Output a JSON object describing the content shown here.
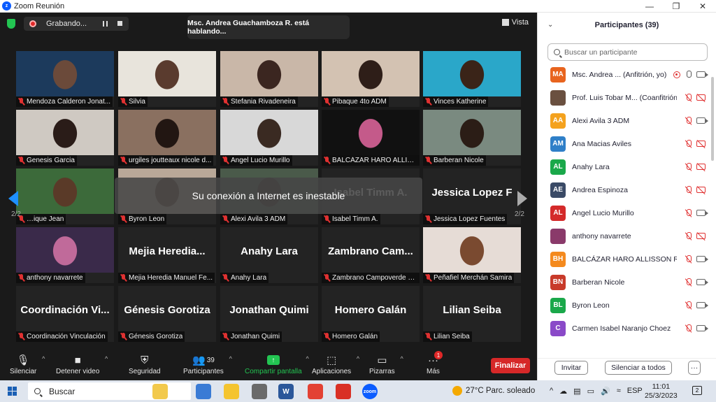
{
  "window": {
    "title": "Zoom Reunión",
    "min": "—",
    "max": "❐",
    "close": "✕"
  },
  "topbar": {
    "recording_label": "Grabando...",
    "speaking": "Msc. Andrea Guachamboza R. está hablando...",
    "view_label": "Vista"
  },
  "toast": "Su conexión a Internet es inestable",
  "page": {
    "left": "2/2",
    "right": "2/2"
  },
  "tiles": [
    {
      "label": "Mendoza Calderon Jonat...",
      "bg": "#1c3a5c",
      "person": "#6b4a3a"
    },
    {
      "label": "Silvia",
      "bg": "#e8e4dc",
      "person": "#5a3b2e"
    },
    {
      "label": "Stefania Rivadeneira",
      "bg": "#c9b7a8",
      "person": "#3b2620"
    },
    {
      "label": "Pibaque 4to ADM",
      "bg": "#d3c2b2",
      "person": "#2e1e18"
    },
    {
      "label": "Vinces Katherine",
      "bg": "#2aa7c9",
      "person": "#3a2418"
    },
    {
      "label": "Genesis Garcia",
      "bg": "#cfc9c2",
      "person": "#2a1c18"
    },
    {
      "label": "urgiles joutteaux nicole d...",
      "bg": "#8a7060",
      "person": "#221612"
    },
    {
      "label": "Angel Lucio Murillo",
      "bg": "#d8d8d8",
      "person": "#3a2a22"
    },
    {
      "label": "BALCÁZAR HARO ALLISS...",
      "bg": "#111111",
      "person": "#c45a8a"
    },
    {
      "label": "Barberan Nicole",
      "bg": "#7a8a80",
      "person": "#2b1d16"
    },
    {
      "label": "…ique Jean",
      "bg": "#3c6a3a",
      "person": "#5a3a28"
    },
    {
      "label": "Byron Leon",
      "bg": "#b9a898",
      "person": "#6a4a3a"
    },
    {
      "label": "Alexi Avila 3 ADM",
      "bg": "#4a5a4a",
      "person": "#3a2a22"
    },
    {
      "label": "Isabel Timm A.",
      "bg": "#232323",
      "person": "",
      "big": "Isabel Timm A."
    },
    {
      "label": "Jessica Lopez Fuentes",
      "bg": "#232323",
      "person": "",
      "big": "Jessica Lopez F"
    },
    {
      "label": "anthony navarrete",
      "bg": "#3a2a4a",
      "person": "#c06a9a"
    },
    {
      "label": "Mejia Heredia Manuel Fe...",
      "bg": "#232323",
      "person": "",
      "big": "Mejia  Heredia..."
    },
    {
      "label": "Anahy Lara",
      "bg": "#232323",
      "person": "",
      "big": "Anahy Lara"
    },
    {
      "label": "Zambrano Campoverde S...",
      "bg": "#232323",
      "person": "",
      "big": "Zambrano  Cam..."
    },
    {
      "label": "Peñafiel Merchán Samira",
      "bg": "#e6dcd6",
      "person": "#7a4a30"
    },
    {
      "label": "Coordinación Vinculación",
      "bg": "#232323",
      "person": "",
      "big": "Coordinación  Vi..."
    },
    {
      "label": "Génesis Gorotiza",
      "bg": "#232323",
      "person": "",
      "big": "Génesis Gorotiza"
    },
    {
      "label": "Jonathan Quimi",
      "bg": "#232323",
      "person": "",
      "big": "Jonathan Quimi"
    },
    {
      "label": "Homero Galán",
      "bg": "#232323",
      "person": "",
      "big": "Homero Galán"
    },
    {
      "label": "Lilian Seiba",
      "bg": "#232323",
      "person": "",
      "big": "Lilian Seiba"
    }
  ],
  "controls": {
    "mute": "Silenciar",
    "video": "Detener video",
    "security": "Seguridad",
    "participants": "Participantes",
    "participants_count": "39",
    "share": "Compartir pantalla",
    "apps": "Aplicaciones",
    "whiteboards": "Pizarras",
    "more": "Más",
    "more_badge": "1",
    "end": "Finalizar"
  },
  "panel": {
    "title": "Participantes (39)",
    "search_placeholder": "Buscar un participante",
    "invite": "Invitar",
    "mute_all": "Silenciar a todos",
    "more": "···",
    "participants": [
      {
        "initials": "MA",
        "name": "Msc. Andrea ... (Anfitrión, yo)",
        "color": "#e8641e",
        "mic": "on",
        "cam": "on",
        "rec": true
      },
      {
        "initials": "",
        "name": "Prof. Luis Tobar M... (Coanfitrión)",
        "color": "#6a5040",
        "mic": "off",
        "cam": "off",
        "rec": false
      },
      {
        "initials": "AA",
        "name": "Alexi Avila 3 ADM",
        "color": "#f4a21e",
        "mic": "off",
        "cam": "on",
        "rec": false
      },
      {
        "initials": "AM",
        "name": "Ana Macias Aviles",
        "color": "#2f7fc8",
        "mic": "off",
        "cam": "off",
        "rec": false
      },
      {
        "initials": "AL",
        "name": "Anahy Lara",
        "color": "#1aa84a",
        "mic": "off",
        "cam": "off",
        "rec": false
      },
      {
        "initials": "AE",
        "name": "Andrea Espinoza",
        "color": "#3a4a66",
        "mic": "off",
        "cam": "off",
        "rec": false
      },
      {
        "initials": "AL",
        "name": "Angel Lucio Murillo",
        "color": "#d42a2a",
        "mic": "off",
        "cam": "on",
        "rec": false
      },
      {
        "initials": "",
        "name": "anthony navarrete",
        "color": "#8a3a6a",
        "mic": "off",
        "cam": "off",
        "rec": false
      },
      {
        "initials": "BH",
        "name": "BALCÁZAR HARO ALLISSON R...",
        "color": "#f48a1e",
        "mic": "off",
        "cam": "on",
        "rec": false
      },
      {
        "initials": "BN",
        "name": "Barberan Nicole",
        "color": "#c83a2a",
        "mic": "off",
        "cam": "on",
        "rec": false
      },
      {
        "initials": "BL",
        "name": "Byron Leon",
        "color": "#1aa84a",
        "mic": "off",
        "cam": "on",
        "rec": false
      },
      {
        "initials": "C",
        "name": "Carmen Isabel Naranjo Choez",
        "color": "#8a4ac8",
        "mic": "off",
        "cam": "on",
        "rec": false
      }
    ]
  },
  "taskbar": {
    "search": "Buscar",
    "weather": "27°C  Parc. soleado",
    "lang": "ESP",
    "time": "11:01",
    "date": "25/3/2023",
    "notif_count": "2",
    "tray_up": "^",
    "apps": [
      {
        "label": "",
        "color": "#f2c94c"
      },
      {
        "label": "",
        "color": "#3a7bd5"
      },
      {
        "label": "",
        "color": "#f4c430"
      },
      {
        "label": "",
        "color": "#6a6a6a"
      },
      {
        "label": "W",
        "color": "#2b579a"
      },
      {
        "label": "",
        "color": "#e34133"
      },
      {
        "label": "",
        "color": "#d93025"
      },
      {
        "label": "zoom",
        "color": "#0b5cff"
      }
    ]
  }
}
